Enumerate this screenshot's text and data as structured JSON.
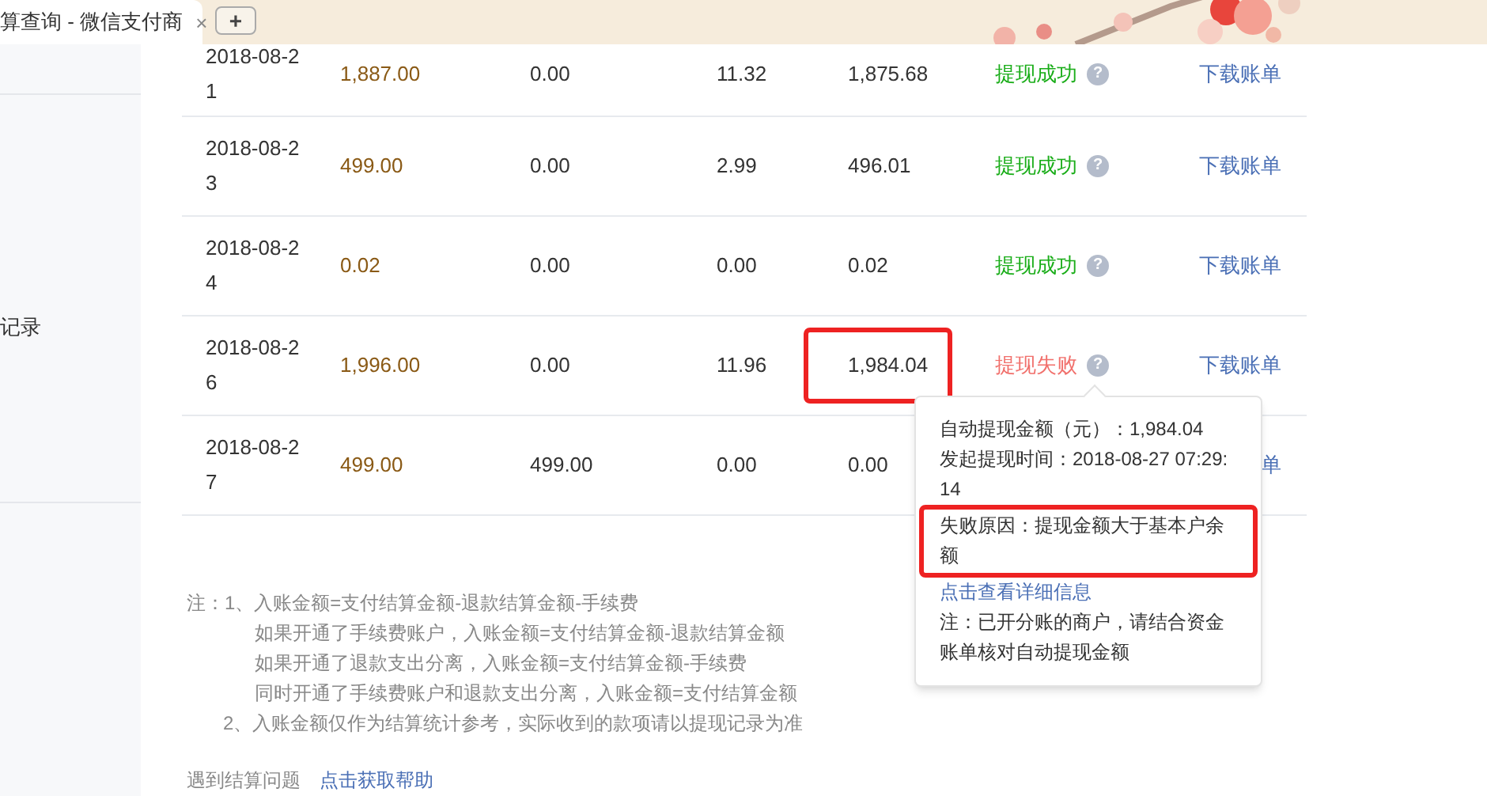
{
  "browser_tab": {
    "title": "算查询 - 微信支付商",
    "close": "×",
    "new_tab": "+"
  },
  "sidebar": {
    "items": [
      {
        "label": "记录"
      }
    ]
  },
  "table": {
    "rows": [
      {
        "date": "2018-08-21",
        "paid": "1,887.00",
        "refund": "0.00",
        "fee": "11.32",
        "net": "1,875.68",
        "highlight": false,
        "status": {
          "label": "提现成功",
          "kind": "success",
          "icon": "?"
        },
        "link": "下载账单"
      },
      {
        "date": "2018-08-23",
        "paid": "499.00",
        "refund": "0.00",
        "fee": "2.99",
        "net": "496.01",
        "highlight": false,
        "status": {
          "label": "提现成功",
          "kind": "success",
          "icon": "?"
        },
        "link": "下载账单"
      },
      {
        "date": "2018-08-24",
        "paid": "0.02",
        "refund": "0.00",
        "fee": "0.00",
        "net": "0.02",
        "highlight": false,
        "status": {
          "label": "提现成功",
          "kind": "success",
          "icon": "?"
        },
        "link": "下载账单"
      },
      {
        "date": "2018-08-26",
        "paid": "1,996.00",
        "refund": "0.00",
        "fee": "11.96",
        "net": "1,984.04",
        "highlight": true,
        "status": {
          "label": "提现失败",
          "kind": "failed",
          "icon": "?"
        },
        "link": "下载账单"
      },
      {
        "date": "2018-08-27",
        "paid": "499.00",
        "refund": "499.00",
        "fee": "0.00",
        "net": "0.00",
        "highlight": false,
        "link": "单"
      }
    ]
  },
  "tooltip": {
    "lines": [
      {
        "kind": "text",
        "text": "自动提现金额（元）：1,984.04",
        "highlighted": false
      },
      {
        "kind": "text",
        "text": "发起提现时间：2018-08-27 07:29:14",
        "highlighted": false
      },
      {
        "kind": "text",
        "text": "失败原因：提现金额大于基本户余额",
        "highlighted": true
      },
      {
        "kind": "link",
        "text": "点击查看详细信息",
        "highlighted": false
      },
      {
        "kind": "text",
        "text": "注：已开分账的商户，请结合资金账单核对自动提现金额",
        "highlighted": false
      }
    ]
  },
  "notes": [
    {
      "kind": "head",
      "text": "注：1、入账金额=支付结算金额-退款结算金额-手续费"
    },
    {
      "kind": "sub",
      "text": "如果开通了手续费账户，入账金额=支付结算金额-退款结算金额"
    },
    {
      "kind": "sub",
      "text": "如果开通了退款支出分离，入账金额=支付结算金额-手续费"
    },
    {
      "kind": "sub",
      "text": "同时开通了手续费账户和退款支出分离，入账金额=支付结算金额"
    },
    {
      "kind": "item",
      "text": "2、入账金额仅作为结算统计参考，实际收到的款项请以提现记录为准"
    }
  ],
  "help": {
    "text": "遇到结算问题",
    "link": "点击获取帮助"
  }
}
